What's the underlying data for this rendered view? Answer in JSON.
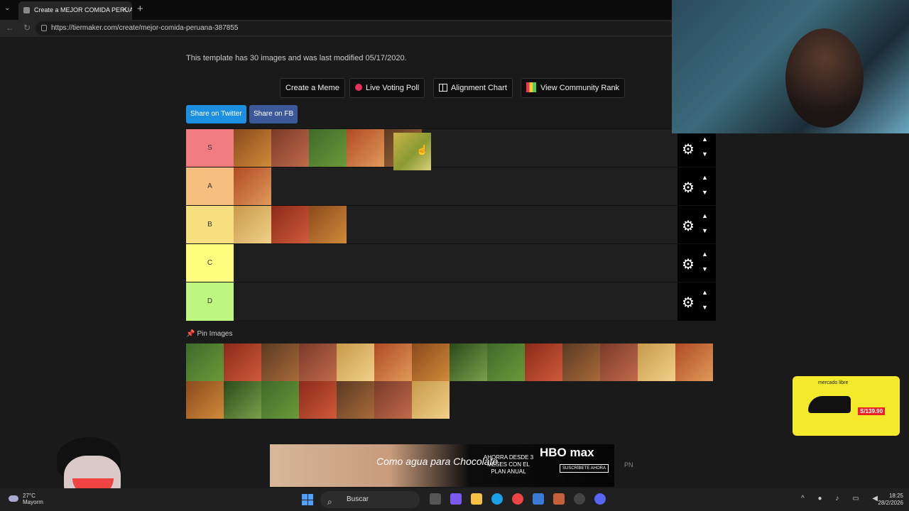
{
  "browser": {
    "tab_title": "Create a MEJOR COMIDA PERUANA",
    "tab_close": "✕",
    "new_tab": "+",
    "url": "https://tiermaker.com/create/mejor-comida-peruana-387855"
  },
  "page": {
    "info": "This template has 30 images and was last modified 05/17/2020.",
    "buttons": {
      "create_meme": "Create a Meme",
      "live_poll": "Live Voting Poll",
      "alignment": "Alignment Chart",
      "community": "View Community Rank"
    },
    "share_twitter": "Share on Twitter",
    "share_fb": "Share on FB",
    "pin_label": "Pin Images"
  },
  "tiers": [
    {
      "label": "S",
      "color": "#f07c7f",
      "count": 5
    },
    {
      "label": "A",
      "color": "#f6bf7f",
      "count": 1
    },
    {
      "label": "B",
      "color": "#f7de7f",
      "count": 3
    },
    {
      "label": "C",
      "color": "#fefe7f",
      "count": 0
    },
    {
      "label": "D",
      "color": "#bef77f",
      "count": 0
    }
  ],
  "pool_count": 21,
  "dragged_item": "food-thumbnail",
  "ads": {
    "brand": "mercado libre",
    "price": "S/139.90",
    "banner_title": "Como agua para Chocolate",
    "banner_promo": "AHORRA DESDE 3 MESES CON EL PLAN ANUAL",
    "banner_brand": "HBO max",
    "banner_cta": "SUSCRÍBETE AHORA",
    "pn": "PN"
  },
  "taskbar": {
    "weather_temp": "27°C",
    "weather_desc": "Mayorm",
    "search": "Buscar",
    "time": "18:25",
    "date": "28/2/2026"
  }
}
